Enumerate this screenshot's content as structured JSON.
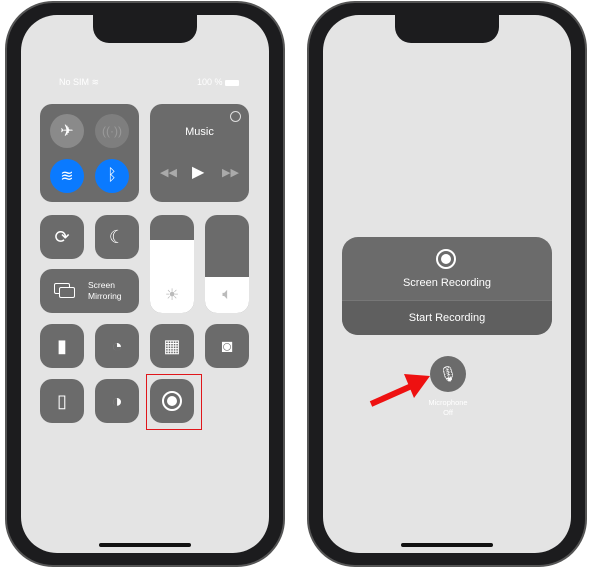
{
  "left_phone": {
    "status": {
      "carrier": "No SIM",
      "battery": "100 %"
    },
    "connectivity": {
      "airplane": false,
      "cellular": false,
      "wifi": true,
      "bluetooth": true,
      "accent": "#0a7aff"
    },
    "music": {
      "title": "Music"
    },
    "screen_mirroring": {
      "line1": "Screen",
      "line2": "Mirroring"
    },
    "brightness_level": 0.74,
    "volume_level": 0.37,
    "highlight_color": "#e0161b"
  },
  "right_phone": {
    "recording": {
      "title": "Screen Recording",
      "action": "Start Recording"
    },
    "microphone": {
      "line1": "Microphone",
      "line2": "Off"
    },
    "arrow_color": "#ee1111"
  }
}
